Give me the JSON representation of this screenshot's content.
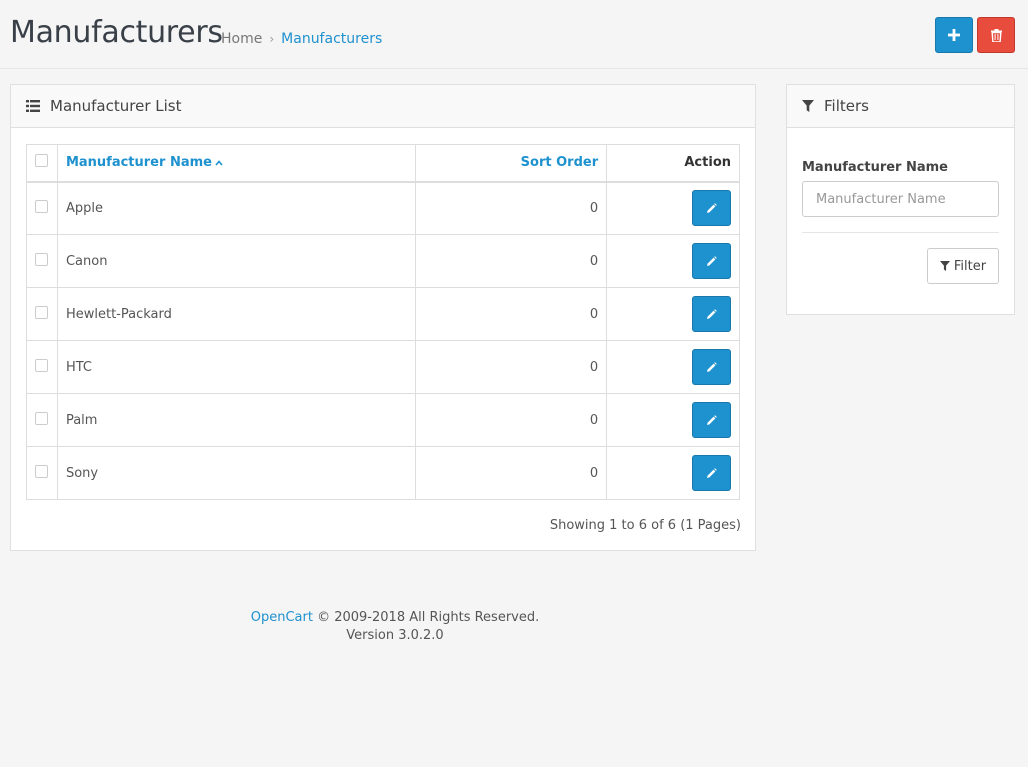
{
  "header": {
    "title": "Manufacturers",
    "breadcrumb": {
      "home": "Home",
      "separator": "›",
      "current": "Manufacturers"
    },
    "add_icon": "plus-icon",
    "delete_icon": "trash-icon"
  },
  "list_panel": {
    "title": "Manufacturer List",
    "icon": "list-icon",
    "columns": {
      "name": "Manufacturer Name",
      "sort_order": "Sort Order",
      "action": "Action"
    },
    "rows": [
      {
        "name": "Apple",
        "sort_order": "0"
      },
      {
        "name": "Canon",
        "sort_order": "0"
      },
      {
        "name": "Hewlett-Packard",
        "sort_order": "0"
      },
      {
        "name": "HTC",
        "sort_order": "0"
      },
      {
        "name": "Palm",
        "sort_order": "0"
      },
      {
        "name": "Sony",
        "sort_order": "0"
      }
    ],
    "results": "Showing 1 to 6 of 6 (1 Pages)"
  },
  "filter_panel": {
    "title": "Filters",
    "icon": "funnel-icon",
    "name_label": "Manufacturer Name",
    "name_value": "",
    "name_placeholder": "Manufacturer Name",
    "button_label": "Filter"
  },
  "footer": {
    "brand": "OpenCart",
    "copyright": "© 2009-2018 All Rights Reserved.",
    "version": "Version 3.0.2.0"
  },
  "colors": {
    "primary": "#1e91cf",
    "danger": "#e74c3c",
    "background": "#f5f5f5"
  }
}
